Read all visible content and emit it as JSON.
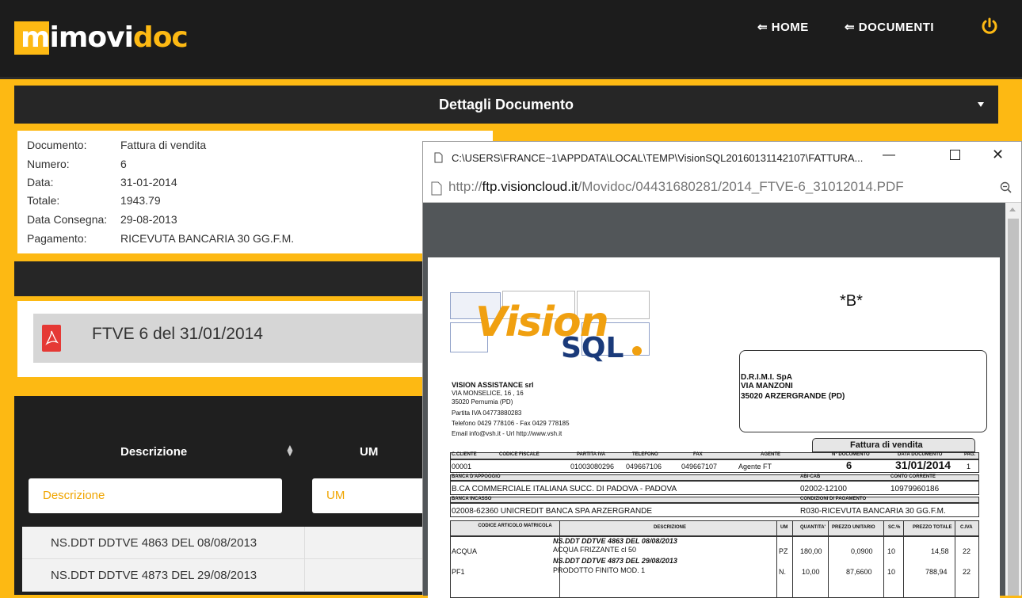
{
  "app": {
    "logo_mi": "mi",
    "logo_movi": "movi",
    "logo_doc": "doc",
    "nav_home": "⇐ HOME",
    "nav_documenti": "⇐ DOCUMENTI",
    "brand_color": "#fdb913"
  },
  "card": {
    "title": "Dettagli Documento"
  },
  "details": [
    {
      "k": "Documento:",
      "v": "Fattura di vendita"
    },
    {
      "k": "Numero:",
      "v": "6"
    },
    {
      "k": "Data:",
      "v": "31-01-2014"
    },
    {
      "k": "Totale:",
      "v": "1943.79"
    },
    {
      "k": "Data Consegna:",
      "v": "29-08-2013"
    },
    {
      "k": "Pagamento:",
      "v": "RICEVUTA BANCARIA 30 GG.F.M."
    }
  ],
  "file": {
    "title": "FTVE 6 del 31/01/2014"
  },
  "table": {
    "col_descrizione": "Descrizione",
    "col_um": "UM",
    "filter_descrizione": "Descrizione",
    "filter_um": "UM",
    "rows": [
      "NS.DDT DDTVE 4863 DEL 08/08/2013",
      "NS.DDT DDTVE 4873 DEL 29/08/2013"
    ]
  },
  "popup": {
    "title": "C:\\USERS\\FRANCE~1\\APPDATA\\LOCAL\\TEMP\\VisionSQL20160131142107\\FATTURA...",
    "url_prefix": "http://",
    "url_host": "ftp.visioncloud.it",
    "url_path": "/Movidoc/04431680281/2014_FTVE-6_31012014.PDF"
  },
  "pdf": {
    "mark": "*B*",
    "logo_vision": "Vision",
    "logo_sql": "SQL",
    "sender": [
      "VISION ASSISTANCE srl",
      "VIA MONSELICE, 16   , 16",
      "35020  Pernumia  (PD)",
      "Partita IVA 04773880283",
      "Telefono 0429 778106 - Fax 0429 778185",
      "Email info@vsh.it - Url http://www.vsh.it"
    ],
    "recipient": [
      "D.R.I.M.I. SpA",
      "VIA MANZONI",
      "35020 ARZERGRANDE (PD)"
    ],
    "doc_type": "Fattura di vendita",
    "h1": [
      "C.CLIENTE",
      "CODICE FISCALE",
      "PARTITA IVA",
      "TELEFONO",
      "FAX",
      "AGENTE",
      "N° DOCUMENTO",
      "DATA DOCUMENTO",
      "PAG."
    ],
    "v1": [
      "00001",
      "",
      "01003080296",
      "049667106",
      "049667107",
      "Agente FT",
      "6",
      "31/01/2014",
      "1"
    ],
    "h_banca_app": "BANCA D'APPOGGIO",
    "banca_app": "B.CA COMMERCIALE ITALIANA SUCC. DI PADOVA - PADOVA",
    "h_abicab": "ABI-CAB",
    "abicab": "02002-12100",
    "h_conto": "CONTO CORRENTE",
    "conto": "10979960186",
    "h_banca_inc": "BANCA INCASSO",
    "banca_inc": "02008-62360  UNICREDIT BANCA SPA ARZERGRANDE",
    "h_cond": "CONDIZIONI DI PAGAMENTO",
    "cond": "R030-RICEVUTA BANCARIA 30 GG.F.M.",
    "h2": [
      "CODICE ARTICOLO MATRICOLA",
      "DESCRIZIONE",
      "UM",
      "QUANTITA'",
      "PREZZO UNITARIO",
      "SC.%",
      "PREZZO TOTALE",
      "C.IVA"
    ],
    "ddt1": "NS.DDT DDTVE 4863 DEL 08/08/2013",
    "r1": [
      "ACQUA",
      "ACQUA FRIZZANTE cl 50",
      "PZ",
      "180,00",
      "0,0900",
      "10",
      "14,58",
      "22"
    ],
    "ddt2": "NS.DDT DDTVE 4873 DEL 29/08/2013",
    "r2": [
      "PF1",
      "PRODOTTO FINITO MOD. 1",
      "N.",
      "10,00",
      "87,6600",
      "10",
      "788,94",
      "22"
    ]
  }
}
